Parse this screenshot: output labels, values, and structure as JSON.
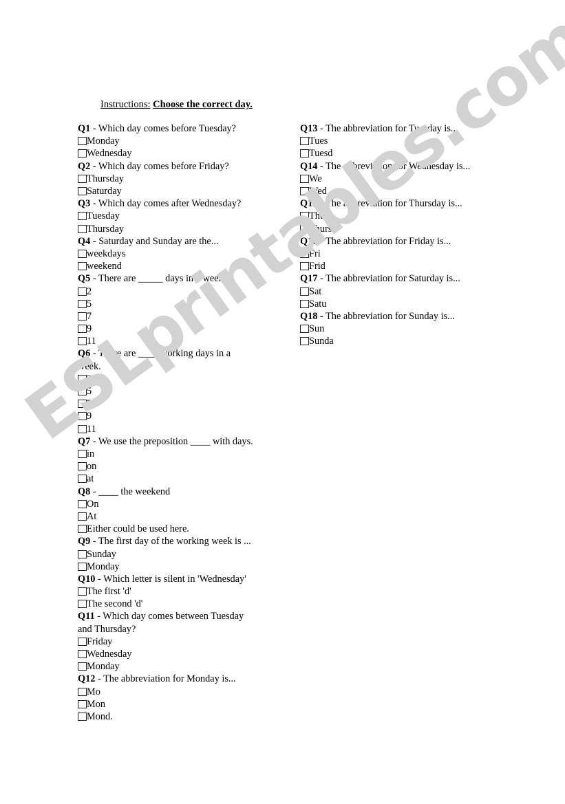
{
  "document": {
    "type": "worksheet",
    "watermark": "ESLprintables.com",
    "watermark_color": "#d2d2d2",
    "background_color": "#ffffff",
    "text_color": "#000000"
  },
  "instructions": {
    "label": "Instructions:",
    "body": "Choose the correct day."
  },
  "columns": {
    "left": [
      {
        "number": "Q1",
        "text": " - Which day comes before Tuesday?",
        "options": [
          "Monday",
          "Wednesday"
        ]
      },
      {
        "number": "Q2",
        "text": " - Which day comes before Friday?",
        "options": [
          "Thursday",
          "Saturday"
        ]
      },
      {
        "number": "Q3",
        "text": " - Which day comes after Wednesday?",
        "options": [
          "Tuesday",
          "Thursday"
        ]
      },
      {
        "number": "Q4",
        "text": " - Saturday and Sunday are the...",
        "options": [
          "weekdays",
          "weekend"
        ]
      },
      {
        "number": "Q5",
        "text": " - There are _____ days in a week",
        "options": [
          "2",
          "5",
          "7",
          "9",
          "11"
        ]
      },
      {
        "number": "Q6",
        "text": " - There are ____ working days in a week.",
        "options": [
          "2",
          "5",
          "7",
          "9",
          "11"
        ]
      },
      {
        "number": "Q7",
        "text": " - We use the preposition ____ with days.",
        "options": [
          "in",
          "on",
          "at"
        ]
      },
      {
        "number": "Q8",
        "text": " - ____ the weekend",
        "options": [
          "On",
          "At",
          "Either could be used here."
        ]
      },
      {
        "number": "Q9",
        "text": " - The first day of the working week is ...",
        "options": [
          "Sunday",
          "Monday"
        ]
      },
      {
        "number": "Q10",
        "text": " - Which letter is silent in 'Wednesday'",
        "options": [
          "The first 'd'",
          "The second 'd'"
        ]
      },
      {
        "number": "Q11",
        "text": " - Which day comes between Tuesday and Thursday?",
        "options": [
          "Friday",
          "Wednesday",
          "Monday"
        ]
      },
      {
        "number": "Q12",
        "text": " - The abbreviation for Monday is...",
        "options": [
          "Mo",
          "Mon",
          "Mond."
        ]
      }
    ],
    "right": [
      {
        "number": "Q13",
        "text": " - The abbreviation for Tuesday is...",
        "options": [
          "Tues",
          "Tuesd"
        ]
      },
      {
        "number": "Q14",
        "text": " - The abbreviation for Wednesday is...",
        "options": [
          "We",
          "Wed"
        ]
      },
      {
        "number": "Q15",
        "text": " - The abbreviation for Thursday is...",
        "options": [
          "Thu",
          "Thurs"
        ]
      },
      {
        "number": "Q16",
        "text": " - The abbreviation for Friday is...",
        "options": [
          "Fri",
          "Frid"
        ]
      },
      {
        "number": "Q17",
        "text": " - The abbreviation for Saturday is...",
        "options": [
          "Sat",
          "Satu"
        ]
      },
      {
        "number": "Q18",
        "text": " - The abbreviation for Sunday is...",
        "options": [
          "Sun",
          "Sunda"
        ]
      }
    ]
  }
}
